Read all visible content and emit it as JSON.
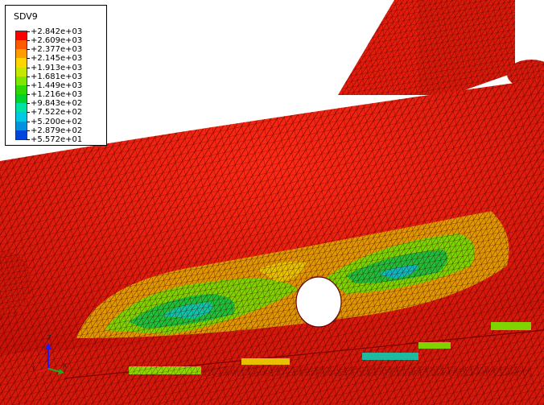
{
  "contour": {
    "variable": "SDV9",
    "levels": [
      {
        "label": "+2.842e+03",
        "color": "#ff0000"
      },
      {
        "label": "+2.609e+03",
        "color": "#ff5a00"
      },
      {
        "label": "+2.377e+03",
        "color": "#ff9c00"
      },
      {
        "label": "+2.145e+03",
        "color": "#ffd600"
      },
      {
        "label": "+1.913e+03",
        "color": "#c6e800"
      },
      {
        "label": "+1.681e+03",
        "color": "#7fe600"
      },
      {
        "label": "+1.449e+03",
        "color": "#2fd800"
      },
      {
        "label": "+1.216e+03",
        "color": "#00d230"
      },
      {
        "label": "+9.843e+02",
        "color": "#00e1a4"
      },
      {
        "label": "+7.522e+02",
        "color": "#00c8e4"
      },
      {
        "label": "+5.200e+02",
        "color": "#0091e0"
      },
      {
        "label": "+2.879e+02",
        "color": "#0046dc"
      },
      {
        "label": "+5.572e+01",
        "color": "#0000d8"
      }
    ]
  },
  "triad": {
    "x_label": "X",
    "y_label": "Y",
    "z_label": "Z"
  },
  "colors": {
    "background": "#ffffff",
    "mesh": "#5a0000",
    "body": "#e01a0a",
    "hole": "#ffffff"
  }
}
